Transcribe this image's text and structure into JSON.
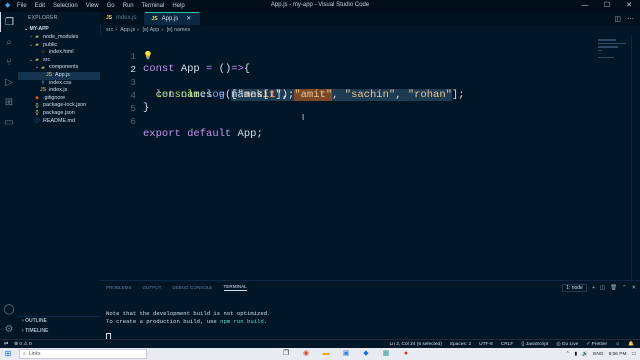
{
  "window": {
    "title": "App.js - my-app - Visual Studio Code",
    "menu": [
      "File",
      "Edit",
      "Selection",
      "View",
      "Go",
      "Run",
      "Terminal",
      "Help"
    ]
  },
  "sidebar": {
    "header": "EXPLORER",
    "project": "MY-APP",
    "tree": [
      {
        "label": "node_modules",
        "type": "folder",
        "open": false
      },
      {
        "label": "public",
        "type": "folder",
        "open": true
      },
      {
        "label": "index.html",
        "type": "html"
      },
      {
        "label": "src",
        "type": "folder",
        "open": true
      },
      {
        "label": "components",
        "type": "folder",
        "open": true
      },
      {
        "label": "App.js",
        "type": "js",
        "selected": true
      },
      {
        "label": "index.css",
        "type": "css"
      },
      {
        "label": "index.js",
        "type": "js"
      },
      {
        "label": ".gitignore",
        "type": "git"
      },
      {
        "label": "package-lock.json",
        "type": "json"
      },
      {
        "label": "package.json",
        "type": "json"
      },
      {
        "label": "README.md",
        "type": "md"
      }
    ],
    "outline": "OUTLINE",
    "timeline": "TIMELINE"
  },
  "tabs": [
    {
      "label": "index.js",
      "active": false
    },
    {
      "label": "App.js",
      "active": true
    }
  ],
  "breadcrumb": [
    "src",
    "App.js",
    "[e] App",
    "[e] names"
  ],
  "editor": {
    "line_numbers": [
      "1",
      "2",
      "3",
      "4",
      "5",
      "6"
    ]
  },
  "panel": {
    "tabs": [
      "PROBLEMS",
      "OUTPUT",
      "DEBUG CONSOLE",
      "TERMINAL"
    ],
    "active_tab": "TERMINAL",
    "terminal_select": "1: node",
    "terminal_lines": [
      "Note that the development build is not optimized.",
      "To create a production build, use "
    ],
    "terminal_cmd": "npm run build",
    "terminal_after": "."
  },
  "statusbar": {
    "errors": "0",
    "warnings": "0",
    "cursor": "Ln 2, Col 24 (6 selected)",
    "spaces": "Spaces: 2",
    "encoding": "UTF-8",
    "eol": "CRLF",
    "language": "{} JavaScript",
    "golive": "Go Live",
    "prettier": "Prettier"
  },
  "taskbar": {
    "search_placeholder": "Links",
    "lang": "ENG",
    "time": "9:06 PM"
  },
  "colors": {
    "editor_bg": "#011627",
    "accent": "#21c7a8",
    "highlight": "#7a4a2b"
  }
}
